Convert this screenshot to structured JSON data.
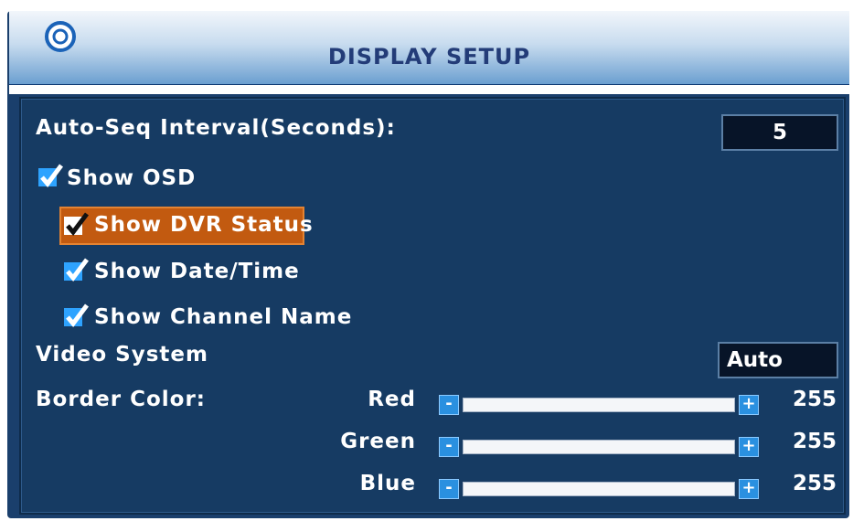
{
  "header": {
    "title": "DISPLAY SETUP"
  },
  "auto_seq": {
    "label": "Auto-Seq Interval(Seconds):",
    "value": "5"
  },
  "checkboxes": [
    {
      "label": "Show OSD",
      "checked": true
    },
    {
      "label": "Show DVR Status",
      "checked": true,
      "selected": true
    },
    {
      "label": "Show Date/Time",
      "checked": true
    },
    {
      "label": "Show Channel Name",
      "checked": true
    }
  ],
  "video_system": {
    "label": "Video System",
    "value": "Auto"
  },
  "border_color": {
    "label": "Border Color:",
    "sliders": [
      {
        "label": "Red",
        "value": "255",
        "fraction": 1.0
      },
      {
        "label": "Green",
        "value": "255",
        "fraction": 1.0
      },
      {
        "label": "Blue",
        "value": "255",
        "fraction": 1.0
      }
    ],
    "minus_label": "-",
    "plus_label": "+"
  },
  "colors": {
    "panel": "#163b63",
    "highlight": "#c25a10",
    "check": "#2ea3ff"
  },
  "icons": [
    "menu-logo-icon",
    "checkbox-checked-icon",
    "minus-icon",
    "plus-icon"
  ]
}
